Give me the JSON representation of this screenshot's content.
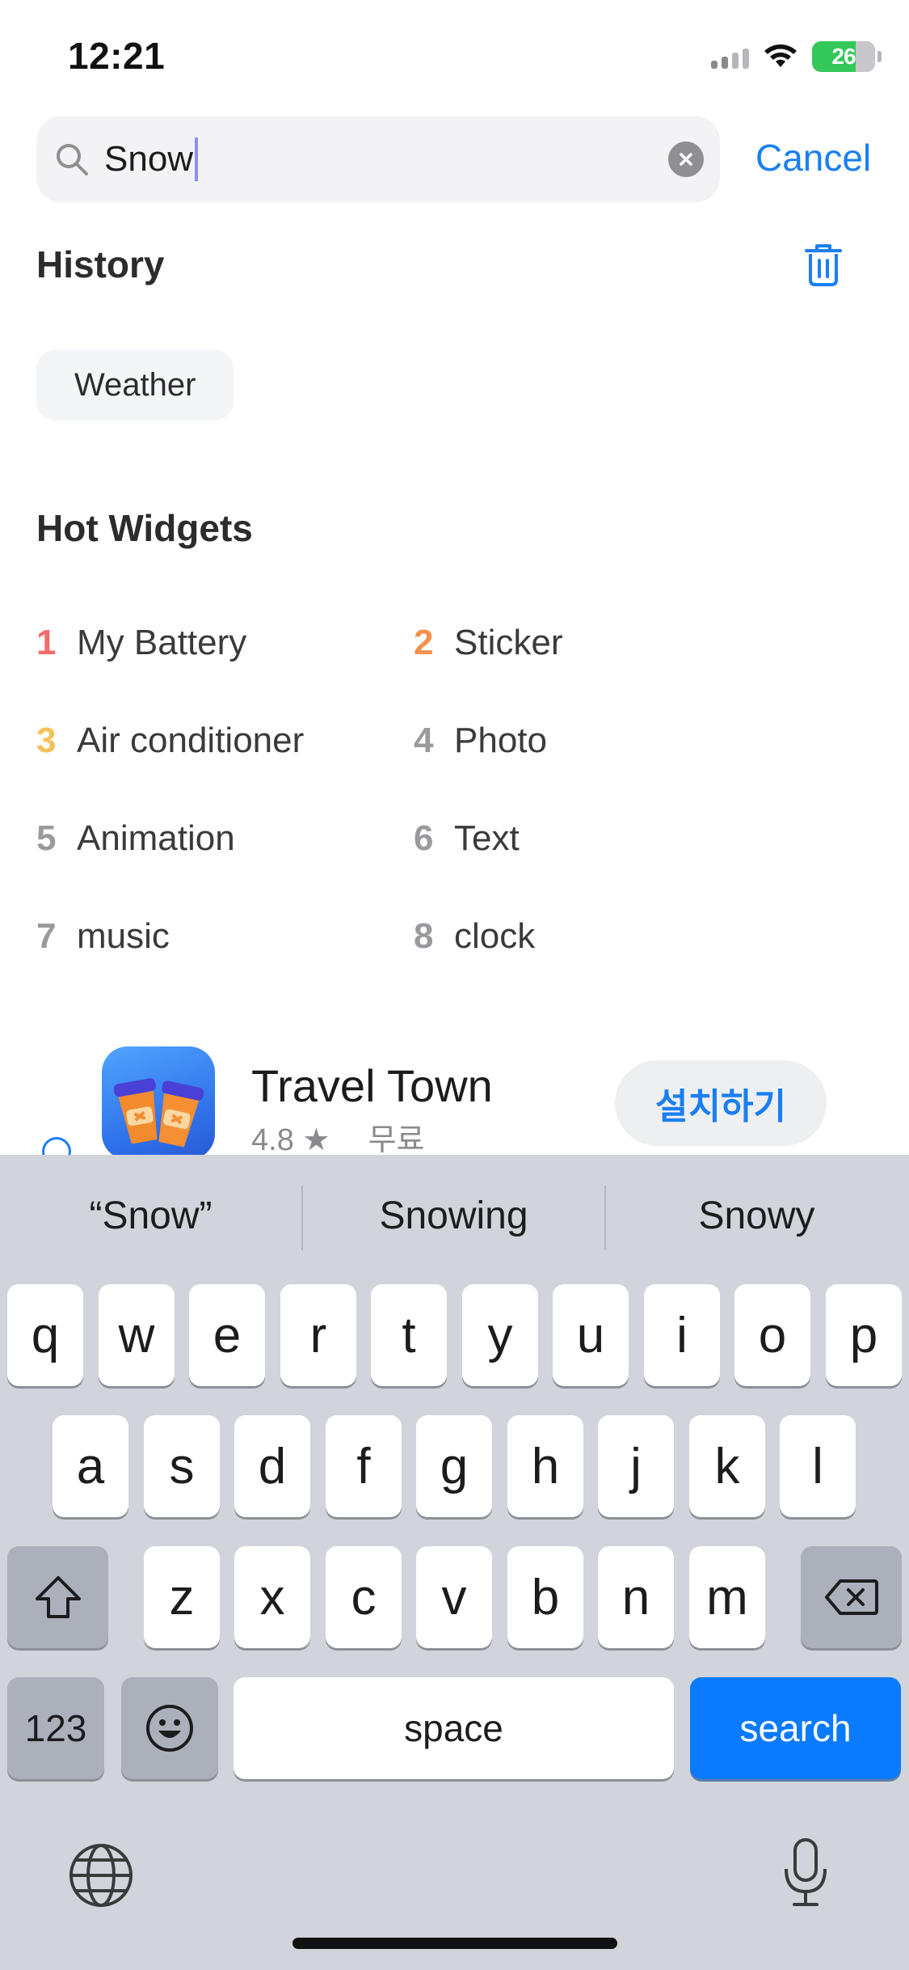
{
  "status_bar": {
    "time": "12:21",
    "battery": "26"
  },
  "search": {
    "query": "Snow",
    "cancel_label": "Cancel"
  },
  "history": {
    "title": "History",
    "chips": [
      "Weather"
    ]
  },
  "hot_widgets": {
    "title": "Hot Widgets",
    "items": [
      {
        "rank": "1",
        "label": "My Battery"
      },
      {
        "rank": "2",
        "label": "Sticker"
      },
      {
        "rank": "3",
        "label": "Air conditioner"
      },
      {
        "rank": "4",
        "label": "Photo"
      },
      {
        "rank": "5",
        "label": "Animation"
      },
      {
        "rank": "6",
        "label": "Text"
      },
      {
        "rank": "7",
        "label": "music"
      },
      {
        "rank": "8",
        "label": "clock"
      }
    ]
  },
  "ad": {
    "app_name": "Travel Town",
    "rating": "4.8 ★",
    "price": "무료",
    "install_label": "설치하기"
  },
  "keyboard": {
    "suggestions": [
      "“Snow”",
      "Snowing",
      "Snowy"
    ],
    "row1": [
      "q",
      "w",
      "e",
      "r",
      "t",
      "y",
      "u",
      "i",
      "o",
      "p"
    ],
    "row2": [
      "a",
      "s",
      "d",
      "f",
      "g",
      "h",
      "j",
      "k",
      "l"
    ],
    "row3": [
      "z",
      "x",
      "c",
      "v",
      "b",
      "n",
      "m"
    ],
    "numbers_label": "123",
    "space_label": "space",
    "search_label": "search"
  },
  "colors": {
    "accent": "#1a7ff2",
    "search_key": "#0a7aff",
    "rank1": "#f26d6d",
    "rank2": "#f5904a",
    "rank3": "#f6c15a"
  }
}
